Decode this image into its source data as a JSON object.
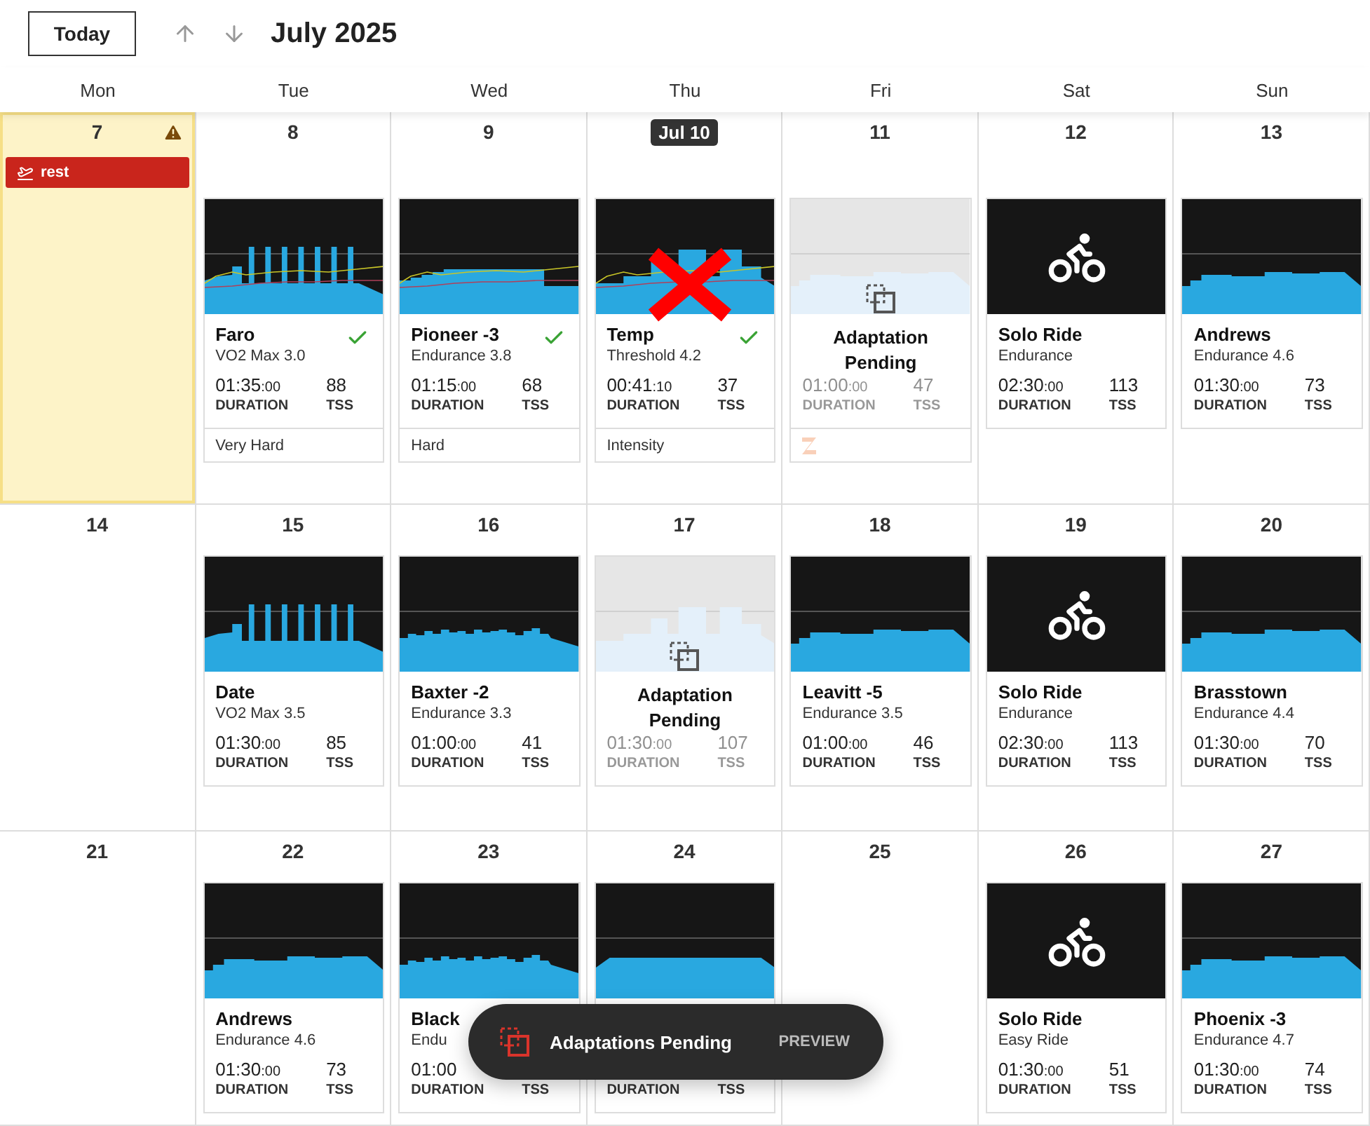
{
  "toolbar": {
    "today_button": "Today",
    "title": "July 2025"
  },
  "weekdays": [
    "Mon",
    "Tue",
    "Wed",
    "Thu",
    "Fri",
    "Sat",
    "Sun"
  ],
  "weeks": [
    {
      "days": [
        {
          "label": "7",
          "today": false,
          "highlighted": true,
          "warning": true,
          "events": [
            {
              "label": "rest"
            }
          ]
        },
        {
          "label": "8",
          "today": false,
          "highlighted": false,
          "warning": false,
          "workout": {
            "kind": "intervals",
            "title": "Faro",
            "subtitle": "VO2 Max 3.0",
            "duration": "01:35",
            "duration_seconds": ":00",
            "tss": "88",
            "duration_label": "DURATION",
            "tss_label": "TSS",
            "completed": true,
            "pending": false,
            "removed": false,
            "footer": {
              "kind": "text",
              "text": "Very Hard"
            }
          }
        },
        {
          "label": "9",
          "today": false,
          "highlighted": false,
          "warning": false,
          "workout": {
            "kind": "ramp",
            "title": "Pioneer -3",
            "subtitle": "Endurance 3.8",
            "duration": "01:15",
            "duration_seconds": ":00",
            "tss": "68",
            "duration_label": "DURATION",
            "tss_label": "TSS",
            "completed": true,
            "pending": false,
            "removed": false,
            "footer": {
              "kind": "text",
              "text": "Hard"
            }
          }
        },
        {
          "label": "Jul 10",
          "today": true,
          "highlighted": false,
          "warning": false,
          "workout": {
            "kind": "threshold",
            "title": "Temp",
            "subtitle": "Threshold 4.2",
            "duration": "00:41",
            "duration_seconds": ":10",
            "tss": "37",
            "duration_label": "DURATION",
            "tss_label": "TSS",
            "completed": true,
            "pending": false,
            "removed": true,
            "footer": {
              "kind": "text",
              "text": "Intensity"
            }
          }
        },
        {
          "label": "11",
          "today": false,
          "highlighted": false,
          "warning": false,
          "workout": {
            "kind": "steady",
            "duration": "01:00",
            "duration_seconds": ":00",
            "tss": "47",
            "duration_label": "DURATION",
            "tss_label": "TSS",
            "completed": false,
            "pending": true,
            "pending_text": "Adaptation Pending",
            "removed": false,
            "footer": {
              "kind": "zigzag"
            }
          }
        },
        {
          "label": "12",
          "today": false,
          "highlighted": false,
          "warning": false,
          "workout": {
            "kind": "bike",
            "title": "Solo Ride",
            "subtitle": "Endurance",
            "duration": "02:30",
            "duration_seconds": ":00",
            "tss": "113",
            "duration_label": "DURATION",
            "tss_label": "TSS",
            "completed": false,
            "pending": false,
            "removed": false
          }
        },
        {
          "label": "13",
          "today": false,
          "highlighted": false,
          "warning": false,
          "workout": {
            "kind": "steady",
            "title": "Andrews",
            "subtitle": "Endurance 4.6",
            "duration": "01:30",
            "duration_seconds": ":00",
            "tss": "73",
            "duration_label": "DURATION",
            "tss_label": "TSS",
            "completed": false,
            "pending": false,
            "removed": false
          }
        }
      ]
    },
    {
      "days": [
        {
          "label": "14",
          "today": false,
          "highlighted": false,
          "warning": false
        },
        {
          "label": "15",
          "today": false,
          "highlighted": false,
          "warning": false,
          "workout": {
            "kind": "intervals",
            "title": "Date",
            "subtitle": "VO2 Max 3.5",
            "duration": "01:30",
            "duration_seconds": ":00",
            "tss": "85",
            "duration_label": "DURATION",
            "tss_label": "TSS",
            "completed": false,
            "pending": false,
            "removed": false
          }
        },
        {
          "label": "16",
          "today": false,
          "highlighted": false,
          "warning": false,
          "workout": {
            "kind": "bumpy",
            "title": "Baxter -2",
            "subtitle": "Endurance 3.3",
            "duration": "01:00",
            "duration_seconds": ":00",
            "tss": "41",
            "duration_label": "DURATION",
            "tss_label": "TSS",
            "completed": false,
            "pending": false,
            "removed": false
          }
        },
        {
          "label": "17",
          "today": false,
          "highlighted": false,
          "warning": false,
          "workout": {
            "kind": "threshold",
            "duration": "01:30",
            "duration_seconds": ":00",
            "tss": "107",
            "duration_label": "DURATION",
            "tss_label": "TSS",
            "completed": false,
            "pending": true,
            "pending_text": "Adaptation Pending",
            "removed": false
          }
        },
        {
          "label": "18",
          "today": false,
          "highlighted": false,
          "warning": false,
          "workout": {
            "kind": "steady",
            "title": "Leavitt -5",
            "subtitle": "Endurance 3.5",
            "duration": "01:00",
            "duration_seconds": ":00",
            "tss": "46",
            "duration_label": "DURATION",
            "tss_label": "TSS",
            "completed": false,
            "pending": false,
            "removed": false
          }
        },
        {
          "label": "19",
          "today": false,
          "highlighted": false,
          "warning": false,
          "workout": {
            "kind": "bike",
            "title": "Solo Ride",
            "subtitle": "Endurance",
            "duration": "02:30",
            "duration_seconds": ":00",
            "tss": "113",
            "duration_label": "DURATION",
            "tss_label": "TSS",
            "completed": false,
            "pending": false,
            "removed": false
          }
        },
        {
          "label": "20",
          "today": false,
          "highlighted": false,
          "warning": false,
          "workout": {
            "kind": "steady",
            "title": "Brasstown",
            "subtitle": "Endurance 4.4",
            "duration": "01:30",
            "duration_seconds": ":00",
            "tss": "70",
            "duration_label": "DURATION",
            "tss_label": "TSS",
            "completed": false,
            "pending": false,
            "removed": false
          }
        }
      ]
    },
    {
      "days": [
        {
          "label": "21",
          "today": false,
          "highlighted": false,
          "warning": false
        },
        {
          "label": "22",
          "today": false,
          "highlighted": false,
          "warning": false,
          "workout": {
            "kind": "steady",
            "title": "Andrews",
            "subtitle": "Endurance 4.6",
            "duration": "01:30",
            "duration_seconds": ":00",
            "tss": "73",
            "duration_label": "DURATION",
            "tss_label": "TSS",
            "completed": false,
            "pending": false,
            "removed": false
          }
        },
        {
          "label": "23",
          "today": false,
          "highlighted": false,
          "warning": false,
          "workout": {
            "kind": "bumpy",
            "title": "Black",
            "subtitle": "Endu",
            "duration": "01:00",
            "duration_label": "DURATION",
            "tss_label": "TSS",
            "completed": false,
            "pending": false,
            "removed": false
          }
        },
        {
          "label": "24",
          "today": false,
          "highlighted": false,
          "warning": false,
          "workout": {
            "kind": "flat",
            "duration_label": "DURATION",
            "tss_label": "TSS",
            "completed": false,
            "pending": false,
            "removed": false
          }
        },
        {
          "label": "25",
          "today": false,
          "highlighted": false,
          "warning": false
        },
        {
          "label": "26",
          "today": false,
          "highlighted": false,
          "warning": false,
          "workout": {
            "kind": "bike",
            "title": "Solo Ride",
            "subtitle": "Easy Ride",
            "duration": "01:30",
            "duration_seconds": ":00",
            "tss": "51",
            "duration_label": "DURATION",
            "tss_label": "TSS",
            "completed": false,
            "pending": false,
            "removed": false
          }
        },
        {
          "label": "27",
          "today": false,
          "highlighted": false,
          "warning": false,
          "workout": {
            "kind": "steady",
            "title": "Phoenix -3",
            "subtitle": "Endurance 4.7",
            "duration": "01:30",
            "duration_seconds": ":00",
            "tss": "74",
            "duration_label": "DURATION",
            "tss_label": "TSS",
            "completed": false,
            "pending": false,
            "removed": false
          }
        }
      ]
    }
  ],
  "toast": {
    "text": "Adaptations Pending",
    "action": "PREVIEW"
  }
}
